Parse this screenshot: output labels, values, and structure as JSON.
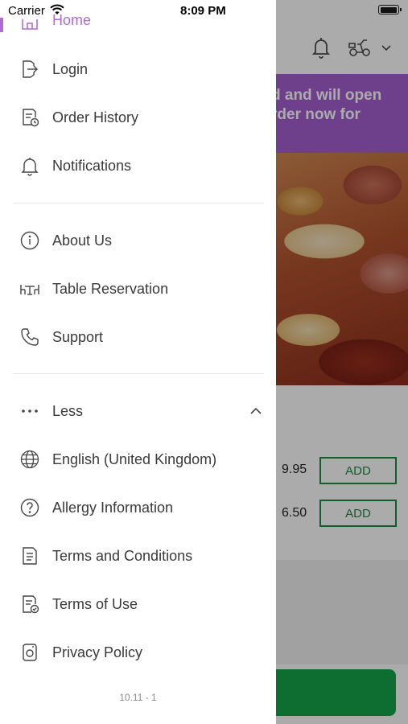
{
  "status_bar": {
    "carrier": "Carrier",
    "time": "8:09 PM"
  },
  "background": {
    "banner_line1": "d and will open",
    "banner_line2": "rder now for",
    "items": [
      {
        "price": "9.95",
        "add_label": "ADD"
      },
      {
        "price": "6.50",
        "add_label": "ADD"
      }
    ]
  },
  "drawer": {
    "home_label": "Home",
    "group1": [
      {
        "label": "Login",
        "icon": "login-icon"
      },
      {
        "label": "Order History",
        "icon": "order-history-icon"
      },
      {
        "label": "Notifications",
        "icon": "bell-icon"
      }
    ],
    "group2": [
      {
        "label": "About Us",
        "icon": "info-icon"
      },
      {
        "label": "Table Reservation",
        "icon": "table-icon"
      },
      {
        "label": "Support",
        "icon": "phone-icon"
      }
    ],
    "less_label": "Less",
    "group3": [
      {
        "label": "English (United Kingdom)",
        "icon": "globe-icon"
      },
      {
        "label": "Allergy Information",
        "icon": "question-icon"
      },
      {
        "label": "Terms and Conditions",
        "icon": "document-icon"
      },
      {
        "label": "Terms of Use",
        "icon": "document-check-icon"
      },
      {
        "label": "Privacy Policy",
        "icon": "privacy-icon"
      }
    ],
    "version": "10.11 - 1"
  },
  "colors": {
    "accent": "#b06ad6",
    "add_green": "#1f8a44",
    "cta_green": "#16a34a"
  }
}
